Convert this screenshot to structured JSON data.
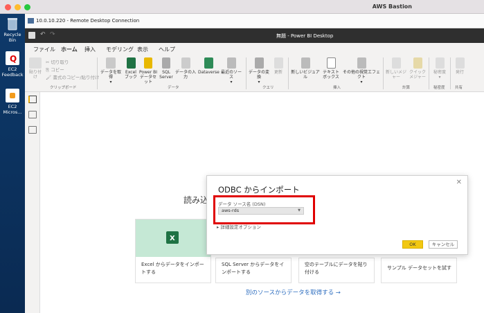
{
  "mac": {
    "title": "AWS Bastion",
    "colors": {
      "close": "#fe5f57",
      "minimize": "#febc2e",
      "zoom": "#28c840"
    }
  },
  "desktop": [
    {
      "label": "Recycle Bin",
      "icon": "recycle-bin-icon"
    },
    {
      "label": "EC2 Feedback",
      "icon": "feedback-icon"
    },
    {
      "label": "EC2 Micros...",
      "icon": "ec2-icon"
    }
  ],
  "rdp": {
    "title": "10.0.10.220 - Remote Desktop Connection"
  },
  "pbi": {
    "title": "無題 - Power BI Desktop",
    "tabs": [
      "ファイル",
      "ホーム",
      "挿入",
      "モデリング",
      "表示",
      "ヘルプ"
    ],
    "clipboard": {
      "paste": "貼り付け",
      "cut": "切り取り",
      "copy": "コピー",
      "format_painter": "書式のコピー/貼り付け",
      "group": "クリップボード"
    },
    "data": {
      "get_data": "データを取得",
      "excel": "Excel ブック",
      "pbi_dataset": "Power BI データセット",
      "sql": "SQL Server",
      "enter_data": "データの入力",
      "dataverse": "Dataverse",
      "recent": "最近のソース",
      "group": "データ"
    },
    "query": {
      "transform": "データの変換",
      "refresh": "更新",
      "group": "クエリ"
    },
    "insert": {
      "new_visual": "新しいビジュアル",
      "textbox": "テキスト ボックス",
      "more_visuals": "その他の視覚エフェクト",
      "group": "挿入"
    },
    "calc": {
      "new_measure": "新しいメジャー",
      "quick_measure": "クイック メジャー",
      "group": "計算"
    },
    "sensitivity": {
      "label": "秘密度",
      "group": "秘密度"
    },
    "share": {
      "publish": "発行",
      "group": "共有"
    }
  },
  "canvas": {
    "welcome": "読み込",
    "cards": [
      {
        "text": "Excel からデータをインポートする"
      },
      {
        "text": "SQL Server からデータをインポートする"
      },
      {
        "text": "空のテーブルにデータを貼り付ける"
      },
      {
        "text": "サンプル データセットを試す"
      }
    ],
    "more_link": "別のソースからデータを取得する →"
  },
  "dialog": {
    "title": "ODBC からインポート",
    "dsn_label": "データ ソース名 (DSN)",
    "dsn_value": "aws-rds",
    "advanced": "詳細設定オプション",
    "ok": "OK",
    "cancel": "キャンセル",
    "close": "✕"
  },
  "highlight_color": "#e00000"
}
